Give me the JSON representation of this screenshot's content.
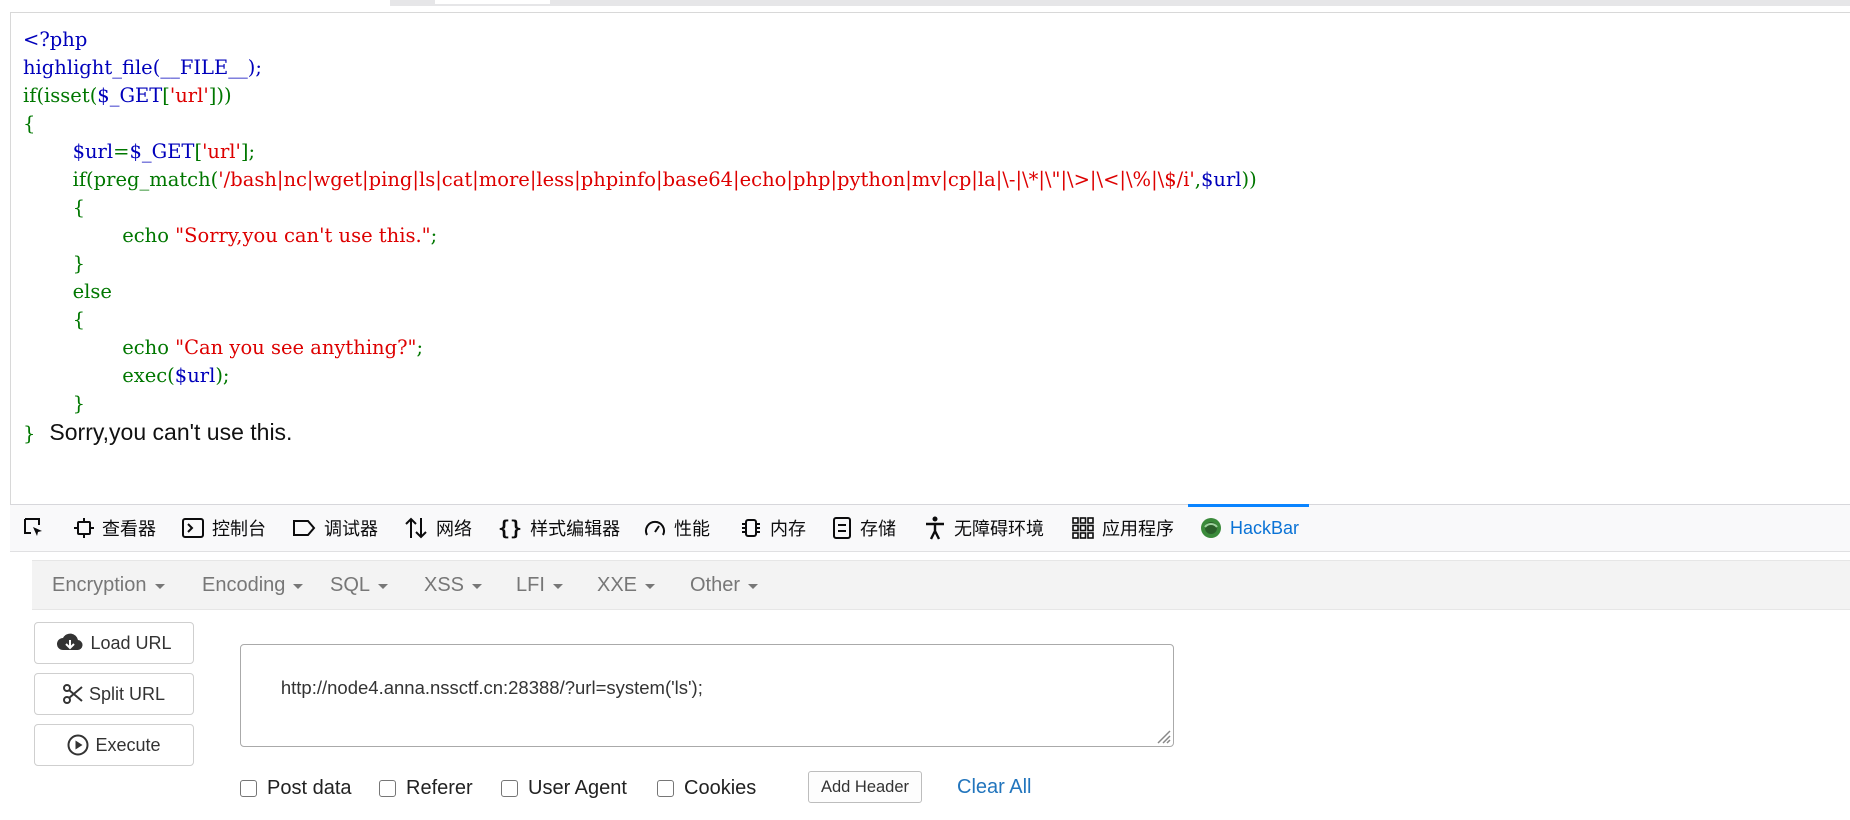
{
  "source": {
    "l1": "<?php",
    "l2": "highlight_file(__FILE__);",
    "l3_a": "if(isset(",
    "l3_b": "$_GET",
    "l3_c": "[",
    "l3_d": "'url'",
    "l3_e": "]))",
    "l4": "{",
    "l5_a": "$url",
    "l5_b": "=",
    "l5_c": "$_GET",
    "l5_d": "[",
    "l5_e": "'url'",
    "l5_f": "];",
    "l6_a": "if(preg_match(",
    "l6_b": "'/bash|nc|wget|ping|ls|cat|more|less|phpinfo|base64|echo|php|python|mv|cp|la|\\-|\\*|\\\"|\\>|\\<|\\%|\\$/i'",
    "l6_c": ",",
    "l6_d": "$url",
    "l6_e": "))",
    "l7": "{",
    "l8_a": "echo ",
    "l8_b": "\"Sorry,you can't use this.\"",
    "l8_c": ";",
    "l9": "}",
    "l10": "else",
    "l11": "{",
    "l12_a": "echo ",
    "l12_b": "\"Can you see anything?\"",
    "l12_c": ";",
    "l13_a": "exec(",
    "l13_b": "$url",
    "l13_c": ");",
    "l14": "}",
    "l15": "}",
    "output": "Sorry,you can't use this."
  },
  "devtools": {
    "tabs": {
      "inspector": "查看器",
      "console": "控制台",
      "debugger": "调试器",
      "network": "网络",
      "style_editor": "样式编辑器",
      "performance": "性能",
      "memory": "内存",
      "storage": "存储",
      "accessibility": "无障碍环境",
      "application": "应用程序",
      "hackbar": "HackBar"
    },
    "active_tab": "HackBar"
  },
  "hackbar": {
    "menus": {
      "encryption": "Encryption",
      "encoding": "Encoding",
      "sql": "SQL",
      "xss": "XSS",
      "lfi": "LFI",
      "xxe": "XXE",
      "other": "Other"
    },
    "load_url": "Load URL",
    "split_url": "Split URL",
    "execute": "Execute",
    "url_value": "http://node4.anna.nssctf.cn:28388/?url=system('ls');",
    "options": {
      "post_data": "Post data",
      "referer": "Referer",
      "user_agent": "User Agent",
      "cookies": "Cookies"
    },
    "add_header": "Add Header",
    "clear_all": "Clear All"
  },
  "colors": {
    "php_default": "#0000bb",
    "php_keyword": "#007700",
    "php_string": "#dd0000",
    "active_tab": "#0a84ff",
    "link": "#2275bd"
  }
}
